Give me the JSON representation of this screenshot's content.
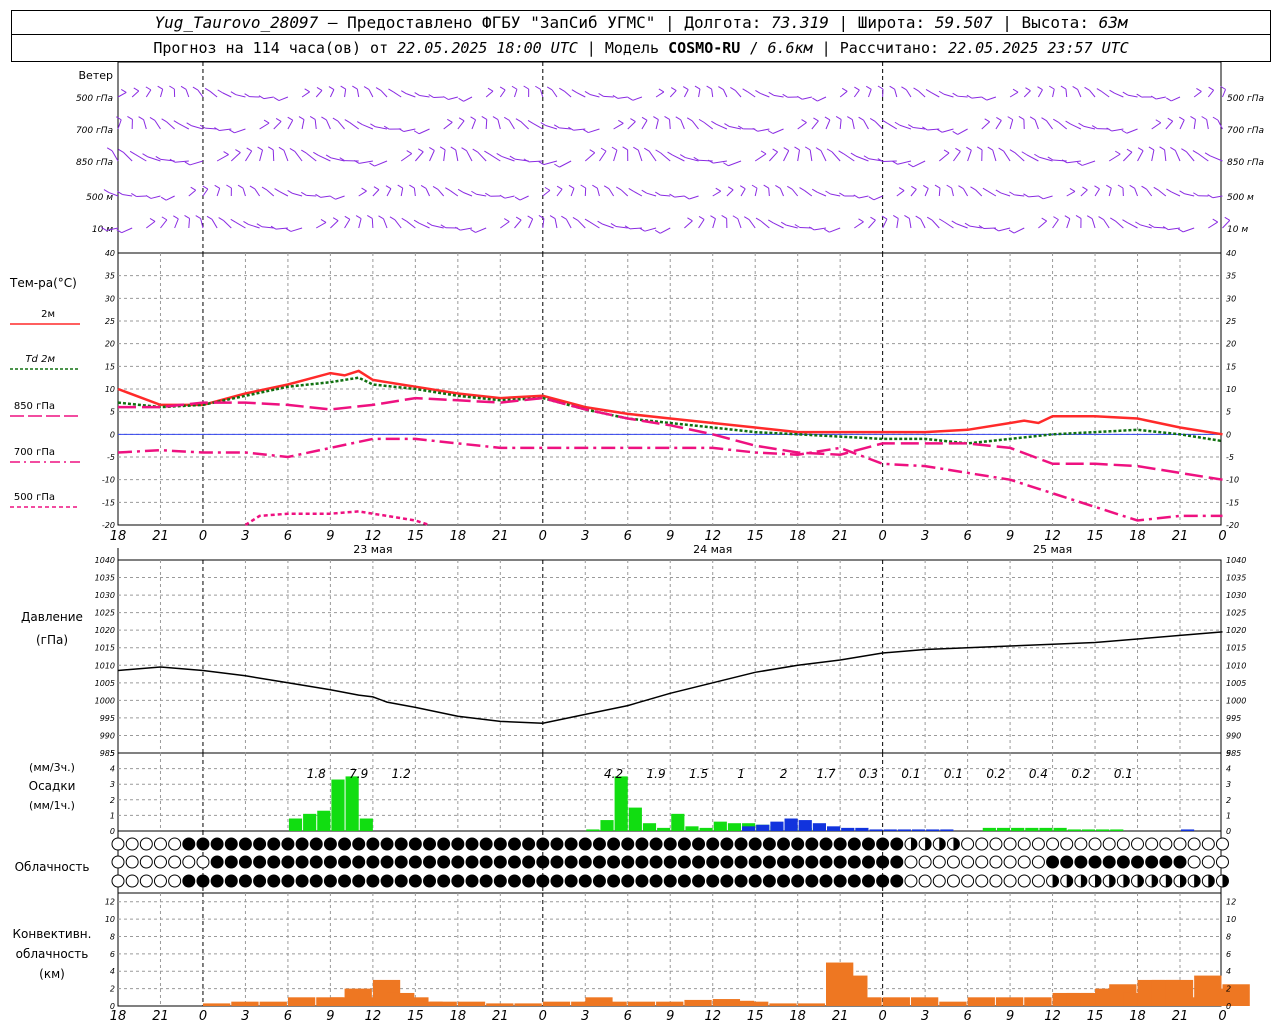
{
  "header": {
    "station": "Yug_Taurovo_28097",
    "provider_sep": " – ",
    "provider": "Предоставлено ФГБУ \"ЗапСиб УГМС\"",
    "lon_label": "Долгота:",
    "lon": "73.319",
    "lat_label": "Широта:",
    "lat": "59.507",
    "alt_label": "Высота:",
    "alt": "63м",
    "forecast_label": "Прогноз на 114 часа(ов) от",
    "forecast_time": "22.05.2025 18:00 UTC",
    "model_label": "Модель",
    "model": "COSMO-RU",
    "model_res": "6.6км",
    "calc_label": "Рассчитано:",
    "calc_time": "22.05.2025 23:57 UTC"
  },
  "colors": {
    "wind": "#8a2be2",
    "t2m": "#ff2a2a",
    "td2m": "#107010",
    "t850": "#ee1180",
    "t700": "#ee1180",
    "t500": "#ee1180",
    "pressure": "#000000",
    "precip_rain": "#11dd11",
    "precip_snow": "#1133dd",
    "convective": "#ee7722",
    "grid": "#9a9a9a"
  },
  "time_axis": {
    "hour_labels": [
      "18",
      "21",
      "0",
      "3",
      "6",
      "9",
      "12",
      "15",
      "18",
      "21",
      "0",
      "3",
      "6",
      "9",
      "12",
      "15",
      "18",
      "21",
      "0",
      "3",
      "6",
      "9",
      "12",
      "15",
      "18",
      "21",
      "0"
    ],
    "day_labels": [
      "23 мая",
      "24 мая",
      "25 мая"
    ]
  },
  "wind_panel": {
    "title": "Ветер",
    "levels": [
      "500 гПа",
      "700 гПа",
      "850 гПа",
      "500 м",
      "10 м"
    ]
  },
  "temperature_panel": {
    "title": "Тем-ра(°С)",
    "legend": [
      "2м",
      "Td 2м",
      "850 гПа",
      "700 гПа",
      "500 гПа"
    ],
    "y_ticks": [
      "40",
      "35",
      "30",
      "25",
      "20",
      "15",
      "10",
      "5",
      "0",
      "-5",
      "-10",
      "-15",
      "-20"
    ]
  },
  "pressure_panel": {
    "title_line1": "Давление",
    "title_line2": "(гПа)",
    "y_ticks": [
      "1040",
      "1035",
      "1030",
      "1025",
      "1020",
      "1015",
      "1010",
      "1005",
      "1000",
      "995",
      "990",
      "985"
    ]
  },
  "precip_panel": {
    "unit_3h": "(мм/3ч.)",
    "title": "Осадки",
    "unit_1h": "(мм/1ч.)",
    "y_ticks": [
      "5",
      "4",
      "3",
      "2",
      "1",
      "0"
    ],
    "totals": [
      {
        "hour": 14,
        "value": "1.8"
      },
      {
        "hour": 17,
        "value": "7.9"
      },
      {
        "hour": 20,
        "value": "1.2"
      },
      {
        "hour": 35,
        "value": "4.2"
      },
      {
        "hour": 38,
        "value": "1.9"
      },
      {
        "hour": 41,
        "value": "1.5"
      },
      {
        "hour": 44,
        "value": "1"
      },
      {
        "hour": 47,
        "value": "2"
      },
      {
        "hour": 50,
        "value": "1.7"
      },
      {
        "hour": 53,
        "value": "0.3"
      },
      {
        "hour": 56,
        "value": "0.1"
      },
      {
        "hour": 59,
        "value": "0.1"
      },
      {
        "hour": 62,
        "value": "0.2"
      },
      {
        "hour": 65,
        "value": "0.4"
      },
      {
        "hour": 68,
        "value": "0.2"
      },
      {
        "hour": 71,
        "value": "0.1"
      }
    ]
  },
  "cloud_panel": {
    "title": "Облачность"
  },
  "convective_panel": {
    "title_line1": "Конвективн.",
    "title_line2": "облачность",
    "title_line3": "(км)",
    "y_ticks": [
      "12",
      "10",
      "8",
      "6",
      "4",
      "2",
      "0"
    ]
  },
  "chart_data": [
    {
      "type": "line",
      "title": "Тем-ра(°С)",
      "x_unit": "hours from 22.05.2025 18:00 UTC",
      "ylim": [
        -20,
        40
      ],
      "series": [
        {
          "name": "2м",
          "x": [
            0,
            3,
            6,
            9,
            12,
            15,
            16,
            17,
            18,
            19,
            20,
            21,
            24,
            27,
            30,
            33,
            36,
            39,
            42,
            45,
            48,
            51,
            54,
            57,
            60,
            63,
            64,
            65,
            66,
            69,
            72,
            75,
            78
          ],
          "values": [
            10,
            6.5,
            6.5,
            9,
            11,
            13.5,
            13,
            14,
            12,
            11.5,
            11,
            10.5,
            9,
            8,
            8.5,
            6,
            4.5,
            3.5,
            2.5,
            1.5,
            0.5,
            0.5,
            0.5,
            0.5,
            1,
            2.5,
            3,
            2.5,
            4,
            4,
            3.5,
            1.5,
            0
          ]
        },
        {
          "name": "Td 2м",
          "x": [
            0,
            3,
            6,
            9,
            12,
            15,
            16,
            17,
            18,
            21,
            24,
            27,
            30,
            33,
            36,
            39,
            42,
            45,
            48,
            51,
            54,
            57,
            60,
            63,
            66,
            69,
            72,
            75,
            78
          ],
          "values": [
            7,
            6,
            6.5,
            8.5,
            10.5,
            11.5,
            12,
            12.5,
            11,
            10,
            8.5,
            7.5,
            8,
            5.5,
            3.5,
            2.5,
            1.5,
            0.5,
            0,
            -0.5,
            -1,
            -1,
            -2,
            -1,
            0,
            0.5,
            1,
            0,
            -1.5
          ]
        },
        {
          "name": "850 гПа",
          "x": [
            0,
            3,
            6,
            9,
            12,
            15,
            18,
            21,
            24,
            27,
            30,
            33,
            36,
            39,
            42,
            45,
            48,
            51,
            54,
            57,
            60,
            63,
            66,
            69,
            72,
            75,
            78
          ],
          "values": [
            6,
            6,
            7,
            7,
            6.5,
            5.5,
            6.5,
            8,
            7.5,
            7,
            8,
            5.5,
            3.5,
            2,
            0,
            -2.5,
            -4,
            -4.5,
            -2,
            -2,
            -2,
            -3,
            -6.5,
            -6.5,
            -7,
            -8.5,
            -10
          ]
        },
        {
          "name": "700 гПа",
          "x": [
            0,
            3,
            6,
            9,
            12,
            15,
            18,
            21,
            24,
            27,
            30,
            33,
            36,
            39,
            42,
            45,
            48,
            51,
            54,
            57,
            60,
            63,
            66,
            69,
            72,
            75,
            78
          ],
          "values": [
            -4,
            -3.5,
            -4,
            -4,
            -5,
            -3,
            -1,
            -1,
            -2,
            -3,
            -3,
            -3,
            -3,
            -3,
            -3,
            -4,
            -4.5,
            -3,
            -6.5,
            -7,
            -8.5,
            -10,
            -13,
            -16,
            -19,
            -18,
            -18
          ]
        },
        {
          "name": "500 гПа",
          "x": [
            9,
            10,
            12,
            15,
            17,
            18,
            19,
            21,
            22
          ],
          "values": [
            -20,
            -18,
            -17.5,
            -17.5,
            -17,
            -17.5,
            -18,
            -19,
            -20
          ]
        }
      ]
    },
    {
      "type": "line",
      "title": "Давление",
      "ylabel": "(гПа)",
      "ylim": [
        985,
        1040
      ],
      "series": [
        {
          "name": "Давление",
          "x": [
            0,
            3,
            6,
            9,
            12,
            15,
            17,
            18,
            19,
            21,
            24,
            27,
            30,
            33,
            36,
            39,
            42,
            45,
            48,
            51,
            54,
            57,
            60,
            63,
            66,
            69,
            72,
            75,
            78
          ],
          "values": [
            1008.5,
            1009.5,
            1008.5,
            1007,
            1005,
            1003,
            1001.5,
            1001,
            999.5,
            998,
            995.5,
            994,
            993.5,
            996,
            998.5,
            1002,
            1005,
            1008,
            1010,
            1011.5,
            1013.5,
            1014.5,
            1015,
            1015.5,
            1016,
            1016.5,
            1017.5,
            1018.5,
            1019.5
          ]
        }
      ]
    },
    {
      "type": "bar",
      "title": "Осадки",
      "ylabel": "(мм/1ч.)",
      "ylim": [
        0,
        5
      ],
      "series": [
        {
          "name": "rain",
          "x": [
            13,
            14,
            15,
            16,
            17,
            18,
            34,
            35,
            36,
            37,
            38,
            39,
            40,
            41,
            42,
            43,
            44,
            45,
            46,
            47,
            48,
            49,
            50,
            51,
            52,
            53,
            54,
            55,
            56,
            57,
            58,
            59,
            60,
            61,
            62,
            63,
            64,
            65,
            66,
            67,
            68,
            69,
            70,
            71,
            72,
            75,
            76,
            77
          ],
          "values": [
            0.8,
            1.1,
            1.3,
            3.3,
            3.5,
            0.8,
            0.1,
            0.7,
            3.5,
            1.5,
            0.5,
            0.2,
            1.1,
            0.3,
            0.2,
            0.6,
            0.5,
            0.5,
            0.4,
            0.3,
            0.2,
            0.2,
            0.1,
            0,
            0,
            0,
            0,
            0,
            0,
            0,
            0,
            0,
            0,
            0,
            0.2,
            0.2,
            0.2,
            0.2,
            0.2,
            0.2,
            0.1,
            0.1,
            0.1,
            0.1,
            0,
            0,
            0,
            0
          ]
        },
        {
          "name": "snow",
          "x": [
            45,
            46,
            47,
            48,
            49,
            50,
            51,
            52,
            53,
            54,
            55,
            56,
            57,
            58,
            59,
            76
          ],
          "values": [
            0.3,
            0.4,
            0.6,
            0.8,
            0.7,
            0.5,
            0.3,
            0.2,
            0.2,
            0.1,
            0.1,
            0.1,
            0.1,
            0.1,
            0.1,
            0.1
          ]
        }
      ]
    },
    {
      "type": "bar",
      "title": "Конвективн. облачность",
      "ylabel": "(км)",
      "ylim": [
        0,
        13
      ],
      "series": [
        {
          "name": "convective",
          "x": [
            6,
            8,
            10,
            12,
            14,
            15,
            16,
            17,
            18,
            19,
            20,
            21,
            22,
            24,
            26,
            28,
            30,
            32,
            33,
            34,
            36,
            38,
            40,
            42,
            43,
            44,
            46,
            48,
            50,
            51,
            52,
            54,
            56,
            58,
            60,
            62,
            64,
            66,
            67,
            68,
            69,
            70,
            71,
            72,
            73,
            74,
            75,
            76,
            77,
            78
          ],
          "values": [
            0.3,
            0.5,
            0.5,
            1,
            1,
            1,
            2,
            1,
            3,
            1.5,
            1,
            0.5,
            0.5,
            0.5,
            0.3,
            0.3,
            0.5,
            0.5,
            1,
            0.5,
            0.5,
            0.5,
            0.7,
            0.8,
            0.6,
            0.5,
            0.3,
            0.3,
            5,
            3.5,
            1,
            1,
            1,
            0.5,
            1,
            1,
            1,
            1.5,
            1.5,
            1.5,
            2,
            2.5,
            1.5,
            3,
            3,
            3,
            1,
            3.5,
            2,
            2.5
          ]
        }
      ]
    }
  ]
}
